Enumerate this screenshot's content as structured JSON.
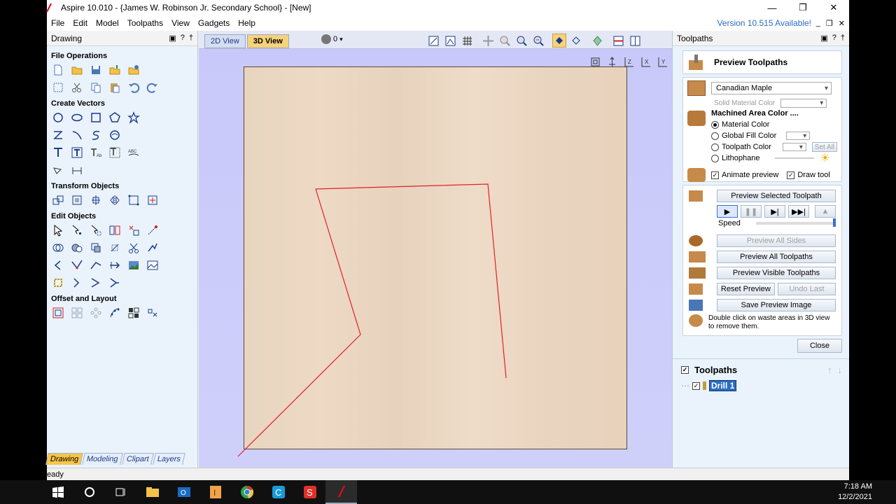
{
  "window": {
    "title": "Aspire 10.010 - {James W. Robinson Jr. Secondary School} - [New]"
  },
  "menu": {
    "items": [
      "File",
      "Edit",
      "Model",
      "Toolpaths",
      "View",
      "Gadgets",
      "Help"
    ],
    "version_notice": "Version 10.515 Available!"
  },
  "left_panel": {
    "title": "Drawing",
    "sections": [
      "File Operations",
      "Create Vectors",
      "Transform Objects",
      "Edit Objects",
      "Offset and Layout"
    ],
    "tabs": [
      "Drawing",
      "Modeling",
      "Clipart",
      "Layers"
    ]
  },
  "view": {
    "tabs": [
      "2D View",
      "3D View"
    ],
    "active_tab": "3D View",
    "layer_count": "0"
  },
  "right_panel": {
    "title": "Toolpaths",
    "preview_title": "Preview Toolpaths",
    "material": "Canadian Maple",
    "solid_material_color": "Solid Material Color",
    "machined_area_color": "Machined Area Color ....",
    "radio": [
      "Material Color",
      "Global Fill Color",
      "Toolpath Color",
      "Lithophane"
    ],
    "set_all": "Set All",
    "animate_preview": "Animate preview",
    "draw_tool": "Draw tool",
    "preview_selected": "Preview Selected Toolpath",
    "speed": "Speed",
    "speed_level": 1.0,
    "preview_all_sides": "Preview All Sides",
    "preview_all": "Preview All Toolpaths",
    "preview_visible": "Preview Visible Toolpaths",
    "reset_preview": "Reset Preview",
    "undo_last": "Undo Last",
    "save_preview": "Save Preview Image",
    "hint": "Double click on waste areas in 3D view to remove them.",
    "close": "Close",
    "toolpaths_header": "Toolpaths",
    "toolpath_items": [
      "Drill 1"
    ]
  },
  "status": {
    "text": "eady"
  },
  "taskbar": {
    "time": "7:18 AM",
    "date": "12/2/2021"
  },
  "colors": {
    "accent": "#2b6cc4",
    "toolpath_line": "#e0202a",
    "tab_active": "#f6c64a"
  }
}
